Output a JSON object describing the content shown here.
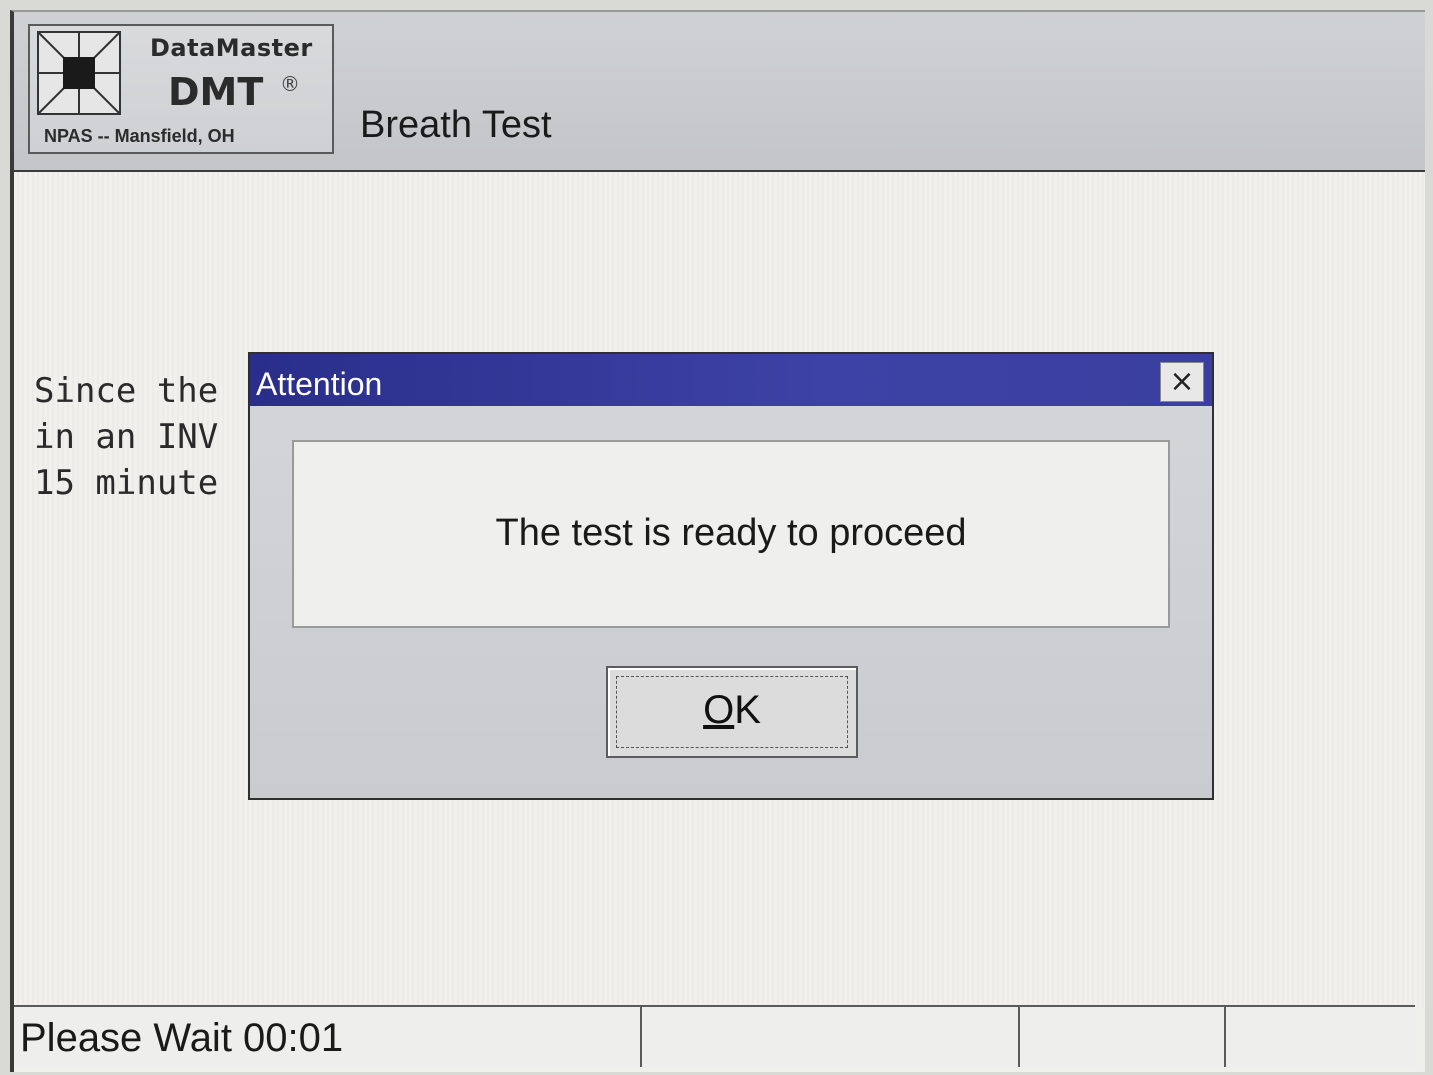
{
  "header": {
    "logo": {
      "name": "DataMaster",
      "model": "DMT",
      "registered": "®",
      "location": "NPAS -- Mansfield, OH",
      "icon": "datamaster-logo-icon"
    },
    "title": "Breath Test"
  },
  "body": {
    "instructions_lines": [
      "Since the",
      "in an INV",
      "15 minute"
    ]
  },
  "dialog": {
    "title": "Attention",
    "close_label": "×",
    "message": "The test is ready to proceed",
    "ok_label": "OK",
    "ok_mnemonic": "O",
    "ok_rest": "K"
  },
  "status_bar": {
    "text": "Please Wait 00:01"
  },
  "colors": {
    "titlebar": "#3a3fa0",
    "background": "#efefec",
    "header": "#c8c9cd"
  }
}
